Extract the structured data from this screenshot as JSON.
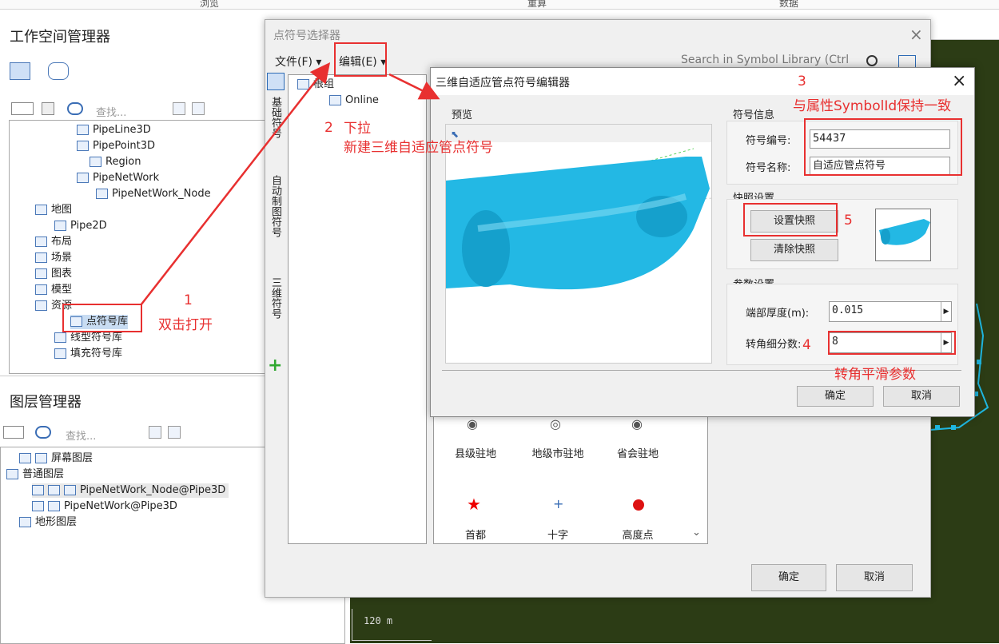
{
  "top_tabs": [
    "浏览",
    "重算",
    "数据"
  ],
  "workspace": {
    "title": "工作空间管理器",
    "search_placeholder": "查找...",
    "tree": [
      {
        "label": "PipeLine3D",
        "icon": "line3d-icon"
      },
      {
        "label": "PipePoint3D",
        "icon": "point3d-icon"
      },
      {
        "label": "Region",
        "icon": "region-icon"
      },
      {
        "label": "PipeNetWork",
        "icon": "network-icon"
      },
      {
        "label": "PipeNetWork_Node",
        "icon": "network-node-icon"
      },
      {
        "label": "地图",
        "icon": "map-icon"
      },
      {
        "label": "Pipe2D",
        "icon": "map-item-icon"
      },
      {
        "label": "布局",
        "icon": "layout-icon"
      },
      {
        "label": "场景",
        "icon": "scene-icon"
      },
      {
        "label": "图表",
        "icon": "chart-icon"
      },
      {
        "label": "模型",
        "icon": "model-icon"
      },
      {
        "label": "资源",
        "icon": "resource-icon"
      },
      {
        "label": "点符号库",
        "icon": "point-symbol-icon"
      },
      {
        "label": "线型符号库",
        "icon": "line-symbol-icon"
      },
      {
        "label": "填充符号库",
        "icon": "fill-symbol-icon"
      }
    ]
  },
  "layers": {
    "title": "图层管理器",
    "search_placeholder": "查找...",
    "items": [
      "屏幕图层",
      "普通图层",
      "PipeNetWork_Node@Pipe3D",
      "PipeNetWork@Pipe3D",
      "地形图层"
    ]
  },
  "selector": {
    "title": "点符号选择器",
    "menu_file": "文件(F)",
    "menu_edit": "编辑(E)",
    "search_placeholder": "Search in Symbol Library (Ctrl",
    "side_tabs": [
      "基础符号",
      "自动制图符号",
      "三维符号"
    ],
    "tree_root": "根组",
    "tree_child": "Online",
    "symbols_row1": [
      "县级驻地",
      "地级市驻地",
      "省会驻地"
    ],
    "symbols_row2": [
      "首都",
      "十字",
      "高度点"
    ],
    "ok": "确定",
    "cancel": "取消"
  },
  "editor": {
    "title": "三维自适应管点符号编辑器",
    "preview_label": "预览",
    "info_group": "符号信息",
    "id_label": "符号编号:",
    "id_value": "54437",
    "name_label": "符号名称:",
    "name_value": "自适应管点符号",
    "snapshot_group": "快照设置",
    "set_snapshot": "设置快照",
    "clear_snapshot": "清除快照",
    "param_group": "参数设置",
    "thickness_label": "端部厚度(m):",
    "thickness_value": "0.015",
    "subdiv_label": "转角细分数:",
    "subdiv_value": "8",
    "ok": "确定",
    "cancel": "取消"
  },
  "annotations": {
    "n1": "1",
    "n1_text": "双击打开",
    "n2": "2",
    "n2_text_a": "下拉",
    "n2_text_b": "新建三维自适应管点符号",
    "n3": "3",
    "n3_text": "与属性SymbolId保持一致",
    "n4": "4",
    "n4_text": "转角平滑参数",
    "n5": "5"
  },
  "map": {
    "scale": "120 m"
  },
  "colors": {
    "annotation": "#e83030",
    "pipe": "#1fb7e0",
    "map_bg": "#2c3c15"
  }
}
